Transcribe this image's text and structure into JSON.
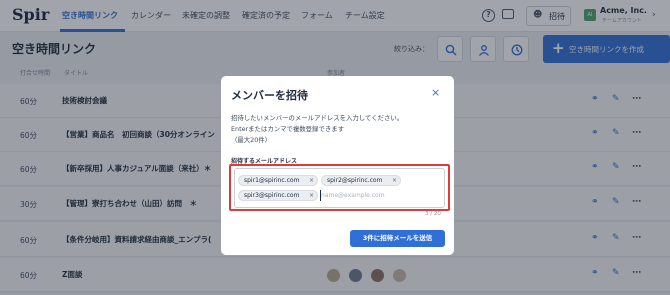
{
  "header": {
    "logo": "Spir",
    "nav": [
      "空き時間リンク",
      "カレンダー",
      "未確定の調整",
      "確定済の予定",
      "フォーム",
      "チーム設定"
    ],
    "help_icon": "?",
    "invite_label": "招待",
    "account_icon": "AI",
    "account_name": "Acme, Inc.",
    "account_sub": "チームアカウント"
  },
  "toolbar": {
    "page_title": "空き時間リンク",
    "filter_label": "絞り込み：",
    "create_label": "空き時間リンクを作成"
  },
  "table": {
    "headers": [
      "打合せ時間",
      "タイトル",
      "参加者"
    ],
    "rows": [
      {
        "duration": "60分",
        "title": "技術検討会議"
      },
      {
        "duration": "60分",
        "title": "【営業】商品名　初回商談（30分オンライン"
      },
      {
        "duration": "60分",
        "title": "【新卒採用】人事カジュアル面談（来社）＊"
      },
      {
        "duration": "30分",
        "title": "【管理】寮打ち合わせ（山田）訪問　＊"
      },
      {
        "duration": "60分",
        "title": "【条件分岐用】資料請求経由商談_エンプラ("
      },
      {
        "duration": "60分",
        "title": "Z面談"
      }
    ],
    "avatar_colors": [
      "#b9a98f",
      "#6b7a8f",
      "#8d6e63",
      "#c9b8a8"
    ]
  },
  "modal": {
    "title": "メンバーを招待",
    "close": "×",
    "desc1": "招待したいメンバーのメールアドレスを入力してください。",
    "desc2": "Enterまたはカンマで複数登録できます",
    "desc3": "（最大20件）",
    "field_label": "招待するメールアドレス",
    "chips": [
      "spir1@spirinc.com",
      "spir2@spirinc.com",
      "spir3@spirinc.com"
    ],
    "chip_remove": "×",
    "input_placeholder": "name@example.com",
    "input_value": "",
    "counter": "3 / 20",
    "submit": "3件に招待メールを送信"
  }
}
